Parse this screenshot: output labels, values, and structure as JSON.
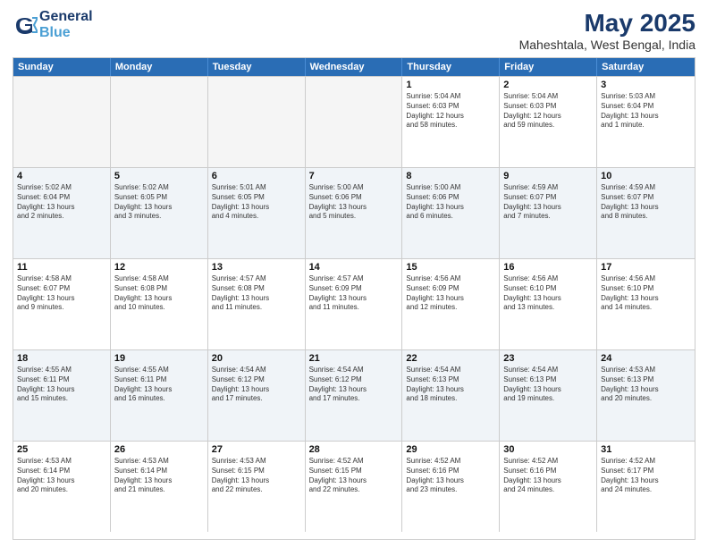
{
  "logo": {
    "line1": "General",
    "line2": "Blue"
  },
  "title": "May 2025",
  "subtitle": "Maheshtala, West Bengal, India",
  "header_days": [
    "Sunday",
    "Monday",
    "Tuesday",
    "Wednesday",
    "Thursday",
    "Friday",
    "Saturday"
  ],
  "rows": [
    [
      {
        "day": "",
        "info": "",
        "empty": true
      },
      {
        "day": "",
        "info": "",
        "empty": true
      },
      {
        "day": "",
        "info": "",
        "empty": true
      },
      {
        "day": "",
        "info": "",
        "empty": true
      },
      {
        "day": "1",
        "info": "Sunrise: 5:04 AM\nSunset: 6:03 PM\nDaylight: 12 hours\nand 58 minutes.",
        "empty": false
      },
      {
        "day": "2",
        "info": "Sunrise: 5:04 AM\nSunset: 6:03 PM\nDaylight: 12 hours\nand 59 minutes.",
        "empty": false
      },
      {
        "day": "3",
        "info": "Sunrise: 5:03 AM\nSunset: 6:04 PM\nDaylight: 13 hours\nand 1 minute.",
        "empty": false
      }
    ],
    [
      {
        "day": "4",
        "info": "Sunrise: 5:02 AM\nSunset: 6:04 PM\nDaylight: 13 hours\nand 2 minutes.",
        "empty": false
      },
      {
        "day": "5",
        "info": "Sunrise: 5:02 AM\nSunset: 6:05 PM\nDaylight: 13 hours\nand 3 minutes.",
        "empty": false
      },
      {
        "day": "6",
        "info": "Sunrise: 5:01 AM\nSunset: 6:05 PM\nDaylight: 13 hours\nand 4 minutes.",
        "empty": false
      },
      {
        "day": "7",
        "info": "Sunrise: 5:00 AM\nSunset: 6:06 PM\nDaylight: 13 hours\nand 5 minutes.",
        "empty": false
      },
      {
        "day": "8",
        "info": "Sunrise: 5:00 AM\nSunset: 6:06 PM\nDaylight: 13 hours\nand 6 minutes.",
        "empty": false
      },
      {
        "day": "9",
        "info": "Sunrise: 4:59 AM\nSunset: 6:07 PM\nDaylight: 13 hours\nand 7 minutes.",
        "empty": false
      },
      {
        "day": "10",
        "info": "Sunrise: 4:59 AM\nSunset: 6:07 PM\nDaylight: 13 hours\nand 8 minutes.",
        "empty": false
      }
    ],
    [
      {
        "day": "11",
        "info": "Sunrise: 4:58 AM\nSunset: 6:07 PM\nDaylight: 13 hours\nand 9 minutes.",
        "empty": false
      },
      {
        "day": "12",
        "info": "Sunrise: 4:58 AM\nSunset: 6:08 PM\nDaylight: 13 hours\nand 10 minutes.",
        "empty": false
      },
      {
        "day": "13",
        "info": "Sunrise: 4:57 AM\nSunset: 6:08 PM\nDaylight: 13 hours\nand 11 minutes.",
        "empty": false
      },
      {
        "day": "14",
        "info": "Sunrise: 4:57 AM\nSunset: 6:09 PM\nDaylight: 13 hours\nand 11 minutes.",
        "empty": false
      },
      {
        "day": "15",
        "info": "Sunrise: 4:56 AM\nSunset: 6:09 PM\nDaylight: 13 hours\nand 12 minutes.",
        "empty": false
      },
      {
        "day": "16",
        "info": "Sunrise: 4:56 AM\nSunset: 6:10 PM\nDaylight: 13 hours\nand 13 minutes.",
        "empty": false
      },
      {
        "day": "17",
        "info": "Sunrise: 4:56 AM\nSunset: 6:10 PM\nDaylight: 13 hours\nand 14 minutes.",
        "empty": false
      }
    ],
    [
      {
        "day": "18",
        "info": "Sunrise: 4:55 AM\nSunset: 6:11 PM\nDaylight: 13 hours\nand 15 minutes.",
        "empty": false
      },
      {
        "day": "19",
        "info": "Sunrise: 4:55 AM\nSunset: 6:11 PM\nDaylight: 13 hours\nand 16 minutes.",
        "empty": false
      },
      {
        "day": "20",
        "info": "Sunrise: 4:54 AM\nSunset: 6:12 PM\nDaylight: 13 hours\nand 17 minutes.",
        "empty": false
      },
      {
        "day": "21",
        "info": "Sunrise: 4:54 AM\nSunset: 6:12 PM\nDaylight: 13 hours\nand 17 minutes.",
        "empty": false
      },
      {
        "day": "22",
        "info": "Sunrise: 4:54 AM\nSunset: 6:13 PM\nDaylight: 13 hours\nand 18 minutes.",
        "empty": false
      },
      {
        "day": "23",
        "info": "Sunrise: 4:54 AM\nSunset: 6:13 PM\nDaylight: 13 hours\nand 19 minutes.",
        "empty": false
      },
      {
        "day": "24",
        "info": "Sunrise: 4:53 AM\nSunset: 6:13 PM\nDaylight: 13 hours\nand 20 minutes.",
        "empty": false
      }
    ],
    [
      {
        "day": "25",
        "info": "Sunrise: 4:53 AM\nSunset: 6:14 PM\nDaylight: 13 hours\nand 20 minutes.",
        "empty": false
      },
      {
        "day": "26",
        "info": "Sunrise: 4:53 AM\nSunset: 6:14 PM\nDaylight: 13 hours\nand 21 minutes.",
        "empty": false
      },
      {
        "day": "27",
        "info": "Sunrise: 4:53 AM\nSunset: 6:15 PM\nDaylight: 13 hours\nand 22 minutes.",
        "empty": false
      },
      {
        "day": "28",
        "info": "Sunrise: 4:52 AM\nSunset: 6:15 PM\nDaylight: 13 hours\nand 22 minutes.",
        "empty": false
      },
      {
        "day": "29",
        "info": "Sunrise: 4:52 AM\nSunset: 6:16 PM\nDaylight: 13 hours\nand 23 minutes.",
        "empty": false
      },
      {
        "day": "30",
        "info": "Sunrise: 4:52 AM\nSunset: 6:16 PM\nDaylight: 13 hours\nand 24 minutes.",
        "empty": false
      },
      {
        "day": "31",
        "info": "Sunrise: 4:52 AM\nSunset: 6:17 PM\nDaylight: 13 hours\nand 24 minutes.",
        "empty": false
      }
    ]
  ]
}
